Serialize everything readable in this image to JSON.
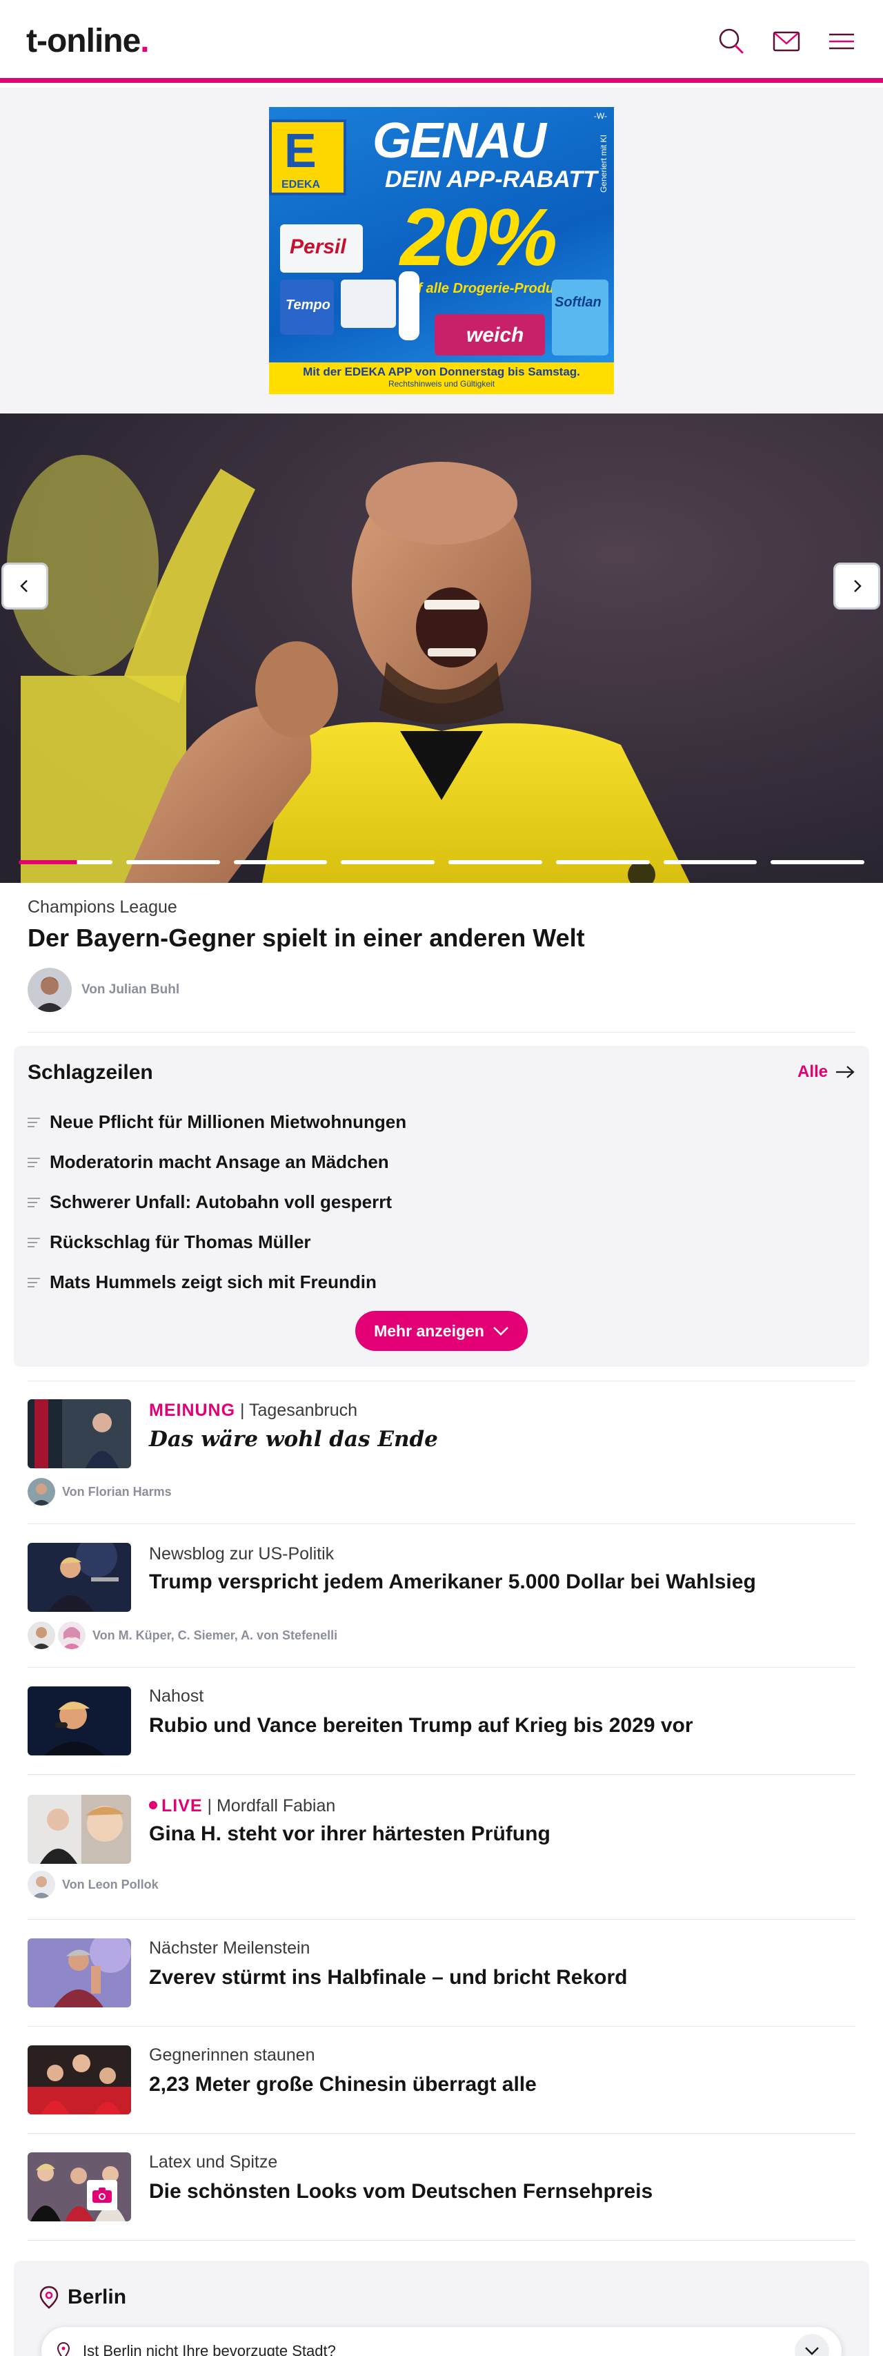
{
  "header": {
    "logo_text": "t-online",
    "logo_dot": ".",
    "accent": "#e20074"
  },
  "ad": {
    "brand": "EDEKA",
    "headline": "GENAU",
    "subline": "DEIN APP-RABATT",
    "percent": "20%",
    "percent_note": "auf alle Drogerie-Produkte!*",
    "side_note": "Generiert mit KI",
    "corner_mark": "-W-",
    "footer_main": "Mit der EDEKA APP von Donnerstag bis Samstag.",
    "footer_sub": "Rechtshinweis und Gültigkeit",
    "product_labels": [
      "Persil",
      "Tempo",
      "weich",
      "Softlan"
    ]
  },
  "hero": {
    "slide_count": 8,
    "active_slide": 1,
    "kicker": "Champions League",
    "title": "Der Bayern-Gegner spielt in einer anderen Welt",
    "author": "Von Julian Buhl"
  },
  "headlines": {
    "title": "Schlagzeilen",
    "all_label": "Alle",
    "items": [
      "Neue Pflicht für Millionen Mietwohnungen",
      "Moderatorin macht Ansage an Mädchen",
      "Schwerer Unfall: Autobahn voll gesperrt",
      "Rückschlag für Thomas Müller",
      "Mats Hummels zeigt sich mit Freundin"
    ],
    "more_label": "Mehr anzeigen"
  },
  "articles": [
    {
      "kicker_accent": "MEINUNG",
      "kicker_sep": " | ",
      "kicker": "Tagesanbruch",
      "title": "Das wäre wohl das Ende",
      "author": "Von Florian Harms"
    },
    {
      "kicker": "Newsblog zur US-Politik",
      "title": "Trump verspricht jedem Amerikaner 5.000 Dollar bei Wahlsieg",
      "author": "Von M. Küper, C. Siemer, A. von Stefenelli"
    },
    {
      "kicker": "Nahost",
      "title": "Rubio und Vance bereiten Trump auf Krieg bis 2029 vor"
    },
    {
      "kicker_accent": "LIVE",
      "kicker_sep": " | ",
      "kicker": "Mordfall Fabian",
      "title": "Gina H. steht vor ihrer härtesten Prüfung",
      "author": "Von Leon Pollok"
    },
    {
      "kicker": "Nächster Meilenstein",
      "title": "Zverev stürmt ins Halbfinale – und bricht Rekord"
    },
    {
      "kicker": "Gegnerinnen staunen",
      "title": "2,23 Meter große Chinesin überragt alle"
    },
    {
      "kicker": "Latex und Spitze",
      "title": "Die schönsten Looks vom Deutschen Fernsehpreis"
    }
  ],
  "local": {
    "city": "Berlin",
    "question": "Ist Berlin nicht Ihre bevorzugte Stadt?"
  }
}
